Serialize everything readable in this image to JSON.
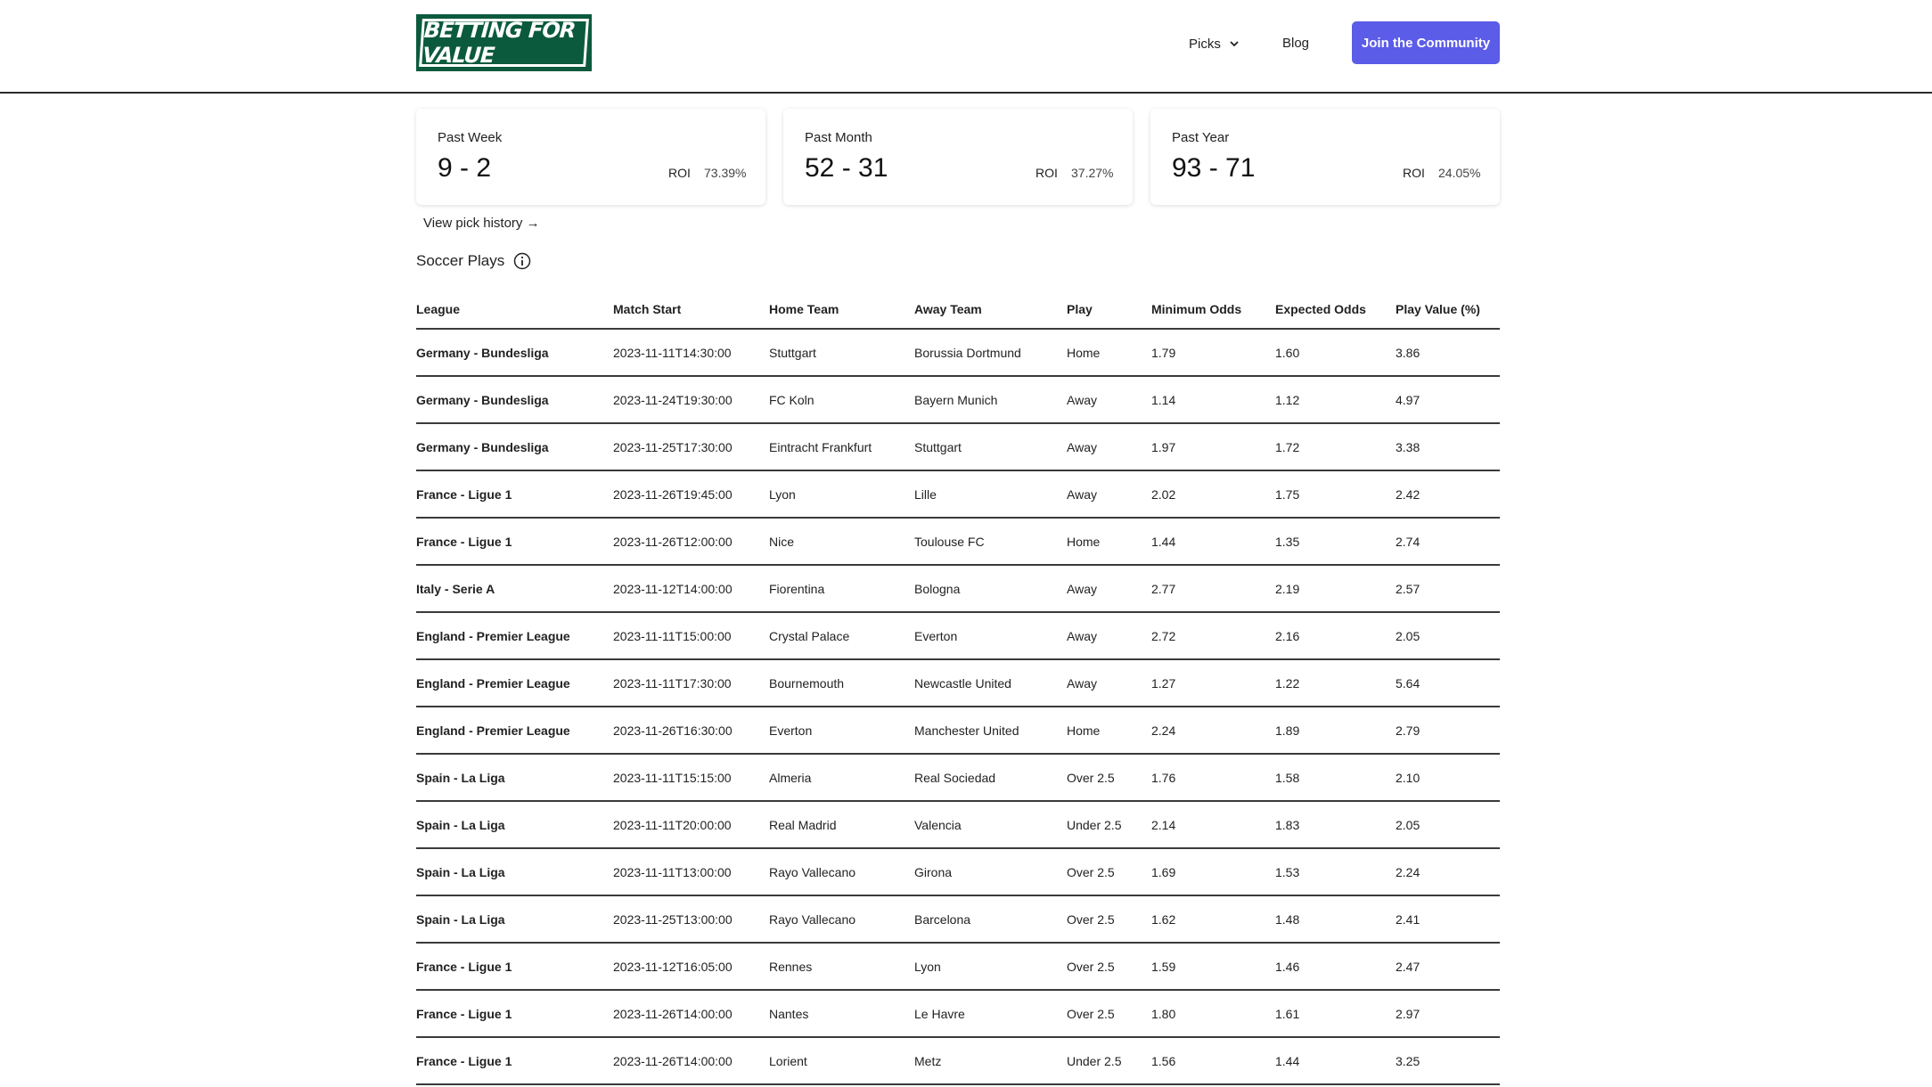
{
  "header": {
    "logo_text": "Betting for Value",
    "nav_picks": "Picks",
    "nav_blog": "Blog",
    "join_button": "Join the Community",
    "icons": {
      "picks_dropdown": "chevron-down-icon"
    }
  },
  "stats": [
    {
      "label": "Past Week",
      "record": "9 - 2",
      "roi_label": "ROI",
      "roi": "73.39%"
    },
    {
      "label": "Past Month",
      "record": "52 - 31",
      "roi_label": "ROI",
      "roi": "37.27%"
    },
    {
      "label": "Past Year",
      "record": "93 - 71",
      "roi_label": "ROI",
      "roi": "24.05%"
    }
  ],
  "view_history": "View pick history →",
  "section": {
    "title": "Soccer Plays",
    "icon": "info-icon"
  },
  "table": {
    "headers": [
      "League",
      "Match Start",
      "Home Team",
      "Away Team",
      "Play",
      "Minimum Odds",
      "Expected Odds",
      "Play Value (%)"
    ],
    "rows": [
      [
        "Germany - Bundesliga",
        "2023-11-11T14:30:00",
        "Stuttgart",
        "Borussia Dortmund",
        "Home",
        "1.79",
        "1.60",
        "3.86"
      ],
      [
        "Germany - Bundesliga",
        "2023-11-24T19:30:00",
        "FC Koln",
        "Bayern Munich",
        "Away",
        "1.14",
        "1.12",
        "4.97"
      ],
      [
        "Germany - Bundesliga",
        "2023-11-25T17:30:00",
        "Eintracht Frankfurt",
        "Stuttgart",
        "Away",
        "1.97",
        "1.72",
        "3.38"
      ],
      [
        "France - Ligue 1",
        "2023-11-26T19:45:00",
        "Lyon",
        "Lille",
        "Away",
        "2.02",
        "1.75",
        "2.42"
      ],
      [
        "France - Ligue 1",
        "2023-11-26T12:00:00",
        "Nice",
        "Toulouse FC",
        "Home",
        "1.44",
        "1.35",
        "2.74"
      ],
      [
        "Italy - Serie A",
        "2023-11-12T14:00:00",
        "Fiorentina",
        "Bologna",
        "Away",
        "2.77",
        "2.19",
        "2.57"
      ],
      [
        "England - Premier League",
        "2023-11-11T15:00:00",
        "Crystal Palace",
        "Everton",
        "Away",
        "2.72",
        "2.16",
        "2.05"
      ],
      [
        "England - Premier League",
        "2023-11-11T17:30:00",
        "Bournemouth",
        "Newcastle United",
        "Away",
        "1.27",
        "1.22",
        "5.64"
      ],
      [
        "England - Premier League",
        "2023-11-26T16:30:00",
        "Everton",
        "Manchester United",
        "Home",
        "2.24",
        "1.89",
        "2.79"
      ],
      [
        "Spain - La Liga",
        "2023-11-11T15:15:00",
        "Almeria",
        "Real Sociedad",
        "Over 2.5",
        "1.76",
        "1.58",
        "2.10"
      ],
      [
        "Spain - La Liga",
        "2023-11-11T20:00:00",
        "Real Madrid",
        "Valencia",
        "Under 2.5",
        "2.14",
        "1.83",
        "2.05"
      ],
      [
        "Spain - La Liga",
        "2023-11-11T13:00:00",
        "Rayo Vallecano",
        "Girona",
        "Over 2.5",
        "1.69",
        "1.53",
        "2.24"
      ],
      [
        "Spain - La Liga",
        "2023-11-25T13:00:00",
        "Rayo Vallecano",
        "Barcelona",
        "Over 2.5",
        "1.62",
        "1.48",
        "2.41"
      ],
      [
        "France - Ligue 1",
        "2023-11-12T16:05:00",
        "Rennes",
        "Lyon",
        "Over 2.5",
        "1.59",
        "1.46",
        "2.47"
      ],
      [
        "France - Ligue 1",
        "2023-11-26T14:00:00",
        "Nantes",
        "Le Havre",
        "Over 2.5",
        "1.80",
        "1.61",
        "2.97"
      ],
      [
        "France - Ligue 1",
        "2023-11-26T14:00:00",
        "Lorient",
        "Metz",
        "Under 2.5",
        "1.56",
        "1.44",
        "3.25"
      ]
    ]
  },
  "colors": {
    "brand": "#0c5a3e",
    "accent": "#5b5ce8"
  }
}
